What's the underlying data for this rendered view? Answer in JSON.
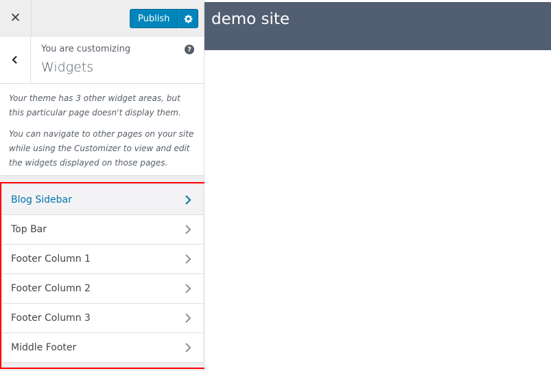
{
  "toolbar": {
    "close_icon": "close-icon",
    "publish_label": "Publish",
    "settings_icon": "gear-icon"
  },
  "panel": {
    "customizing_label": "You are customizing",
    "title": "Widgets",
    "help_icon": "?"
  },
  "description": {
    "paragraph1": "Your theme has 3 other widget areas, but this particular page doesn't display them.",
    "paragraph2": "You can navigate to other pages on your site while using the Customizer to view and edit the widgets displayed on those pages."
  },
  "widgets": [
    {
      "label": "Blog Sidebar",
      "active": true
    },
    {
      "label": "Top Bar",
      "active": false
    },
    {
      "label": "Footer Column 1",
      "active": false
    },
    {
      "label": "Footer Column 2",
      "active": false
    },
    {
      "label": "Footer Column 3",
      "active": false
    },
    {
      "label": "Middle Footer",
      "active": false
    }
  ],
  "preview": {
    "site_title": "demo site"
  },
  "colors": {
    "accent": "#0085ba",
    "highlight": "#ff0000",
    "site_header": "#525e72"
  }
}
